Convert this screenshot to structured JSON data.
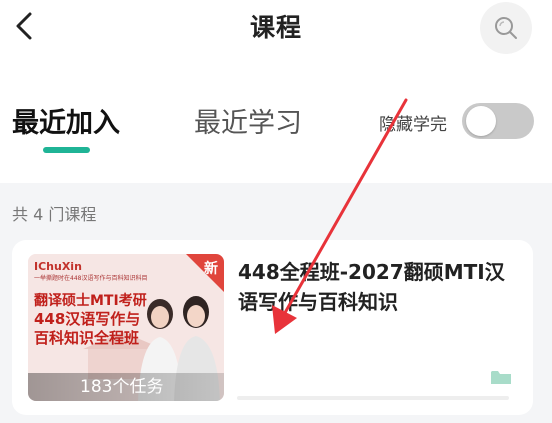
{
  "header": {
    "title": "课程",
    "back_icon": "chevron-left-icon",
    "search_icon": "search-icon"
  },
  "tabs": [
    {
      "label": "最近加入",
      "active": true
    },
    {
      "label": "最近学习",
      "active": false
    }
  ],
  "filter": {
    "hide_completed_label": "隐藏学完",
    "hide_completed_on": false
  },
  "course_count_text": "共 4 门课程",
  "courses": [
    {
      "title": "448全程班-2027翻硕MTI汉语写作与百科知识",
      "task_count_text": "183个任务",
      "new_tag": "新",
      "progress": 0,
      "thumbnail": {
        "brand": "IChuXin",
        "subtitle": "一举撕题时在448汉语写作与百科知识科目",
        "lines": [
          "翻译硕士MTI考研",
          "448汉语写作与",
          "百科知识全程班"
        ]
      }
    }
  ],
  "colors": {
    "accent": "#1fb496",
    "annotation_arrow": "#e8333a",
    "toggle_off": "#c9c9c9"
  }
}
